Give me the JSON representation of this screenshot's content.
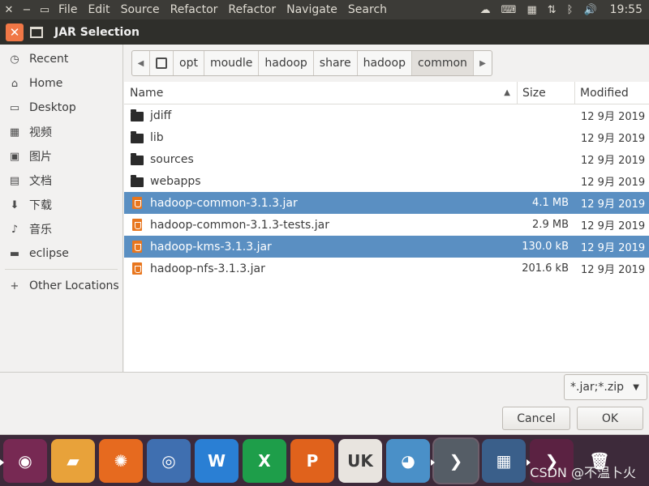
{
  "menubar": {
    "menus": [
      "File",
      "Edit",
      "Source",
      "Refactor",
      "Refactor",
      "Navigate",
      "Search"
    ],
    "clock": "19:55"
  },
  "dialog": {
    "title": "JAR Selection"
  },
  "sidebar": {
    "items": [
      {
        "label": "Recent",
        "icon": "clock-icon",
        "glyph": "◷"
      },
      {
        "label": "Home",
        "icon": "home-icon",
        "glyph": "⌂"
      },
      {
        "label": "Desktop",
        "icon": "desktop-icon",
        "glyph": "▭"
      },
      {
        "label": "视频",
        "icon": "video-icon",
        "glyph": "▦"
      },
      {
        "label": "图片",
        "icon": "picture-icon",
        "glyph": "▣"
      },
      {
        "label": "文档",
        "icon": "document-icon",
        "glyph": "▤"
      },
      {
        "label": "下载",
        "icon": "download-icon",
        "glyph": "⬇"
      },
      {
        "label": "音乐",
        "icon": "music-icon",
        "glyph": "♪"
      },
      {
        "label": "eclipse",
        "icon": "folder-icon",
        "glyph": "▬"
      }
    ],
    "other": {
      "label": "Other Locations",
      "icon": "plus-icon",
      "glyph": "+"
    }
  },
  "pathbar": {
    "segments": [
      "opt",
      "moudle",
      "hadoop",
      "share",
      "hadoop",
      "common"
    ]
  },
  "columns": {
    "name": "Name",
    "size": "Size",
    "modified": "Modified"
  },
  "files": [
    {
      "type": "folder",
      "name": "jdiff",
      "size": "",
      "modified": "12 9月 2019",
      "selected": false
    },
    {
      "type": "folder",
      "name": "lib",
      "size": "",
      "modified": "12 9月 2019",
      "selected": false
    },
    {
      "type": "folder",
      "name": "sources",
      "size": "",
      "modified": "12 9月 2019",
      "selected": false
    },
    {
      "type": "folder",
      "name": "webapps",
      "size": "",
      "modified": "12 9月 2019",
      "selected": false
    },
    {
      "type": "jar",
      "name": "hadoop-common-3.1.3.jar",
      "size": "4.1 MB",
      "modified": "12 9月 2019",
      "selected": true
    },
    {
      "type": "jar",
      "name": "hadoop-common-3.1.3-tests.jar",
      "size": "2.9 MB",
      "modified": "12 9月 2019",
      "selected": false
    },
    {
      "type": "jar",
      "name": "hadoop-kms-3.1.3.jar",
      "size": "130.0 kB",
      "modified": "12 9月 2019",
      "selected": true
    },
    {
      "type": "jar",
      "name": "hadoop-nfs-3.1.3.jar",
      "size": "201.6 kB",
      "modified": "12 9月 2019",
      "selected": false
    }
  ],
  "filter": {
    "value": "*.jar;*.zip"
  },
  "buttons": {
    "cancel": "Cancel",
    "ok": "OK"
  },
  "dock": {
    "apps": [
      {
        "name": "ubuntu-icon",
        "color": "#772953",
        "glyph": "◉"
      },
      {
        "name": "files-icon",
        "color": "#e8a23a",
        "glyph": "▰"
      },
      {
        "name": "firefox-icon",
        "color": "#e66a1f",
        "glyph": "✺"
      },
      {
        "name": "browser-icon",
        "color": "#3f6fb0",
        "glyph": "◎"
      },
      {
        "name": "writer-icon",
        "color": "#2a7fd4",
        "glyph": "W"
      },
      {
        "name": "calc-icon",
        "color": "#1e9e4a",
        "glyph": "X"
      },
      {
        "name": "impress-icon",
        "color": "#e0621c",
        "glyph": "P"
      },
      {
        "name": "software-center-icon",
        "color": "#e8e4df",
        "glyph": "UK"
      },
      {
        "name": "remote-desktop-icon",
        "color": "#4a90c8",
        "glyph": "◕"
      },
      {
        "name": "vscode-icon",
        "color": "#555d66",
        "glyph": "❯"
      },
      {
        "name": "workspace-switcher-icon",
        "color": "#3a5f8a",
        "glyph": "▦"
      },
      {
        "name": "terminal-icon",
        "color": "#5b2242",
        "glyph": "❯"
      },
      {
        "name": "trash-icon",
        "color": "#3d2a3a",
        "glyph": "🗑"
      }
    ]
  },
  "watermark": "CSDN @不温卜火"
}
